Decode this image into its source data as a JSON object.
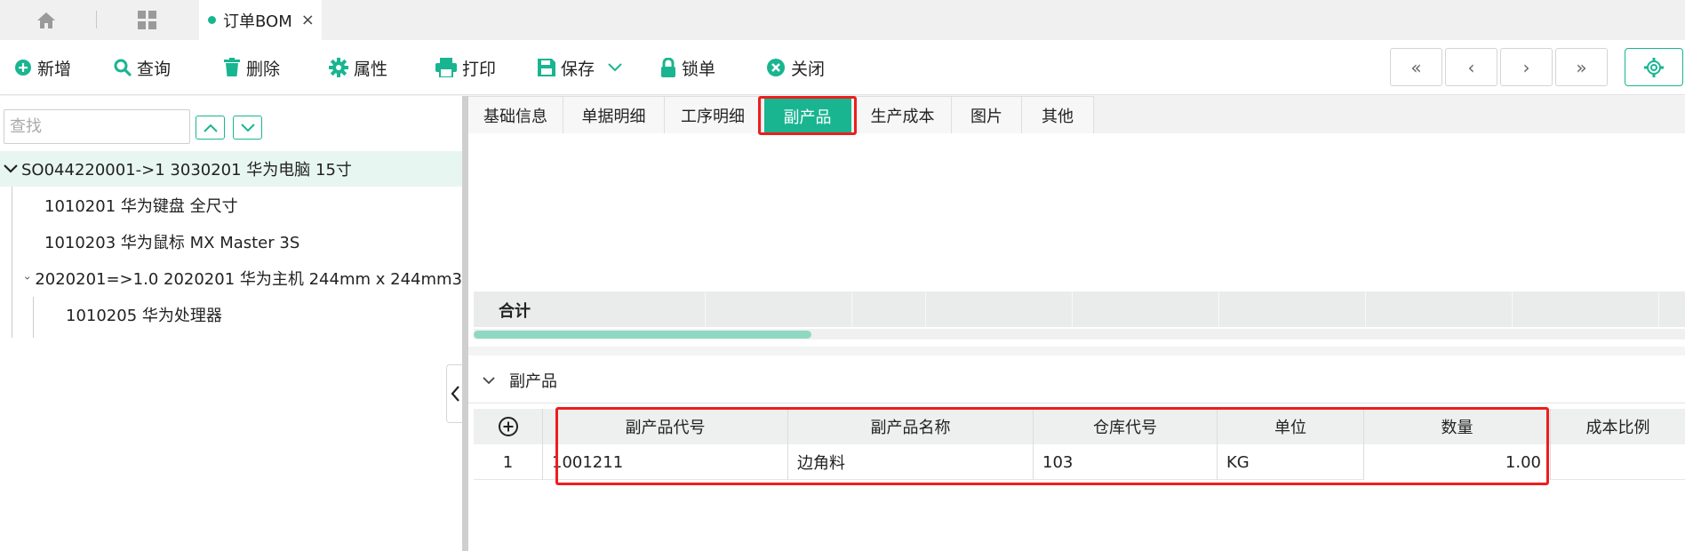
{
  "doc_tab": {
    "title": "订单BOM",
    "close": "×"
  },
  "toolbar": {
    "add": "新增",
    "query": "查询",
    "delete": "删除",
    "properties": "属性",
    "print": "打印",
    "save": "保存",
    "lock": "锁单",
    "close": "关闭"
  },
  "nav": {
    "first": "«",
    "prev": "‹",
    "next": "›",
    "last": "»"
  },
  "search": {
    "placeholder": "查找",
    "value": ""
  },
  "tree": {
    "root": "SO044220001->1 3030201 华为电脑 15寸",
    "items": [
      "1010201 华为键盘 全尺寸",
      "1010203 华为鼠标 MX Master 3S",
      "2020201=>1.0 2020201 华为主机 244mm x 244mm3",
      "1010205 华为处理器"
    ]
  },
  "tabs": [
    "基础信息",
    "单据明细",
    "工序明细",
    "副产品",
    "生产成本",
    "图片",
    "其他"
  ],
  "active_tab": "副产品",
  "upper_grid": {
    "sum_label": "合计"
  },
  "section": {
    "title": "副产品"
  },
  "grid": {
    "columns": [
      "副产品代号",
      "副产品名称",
      "仓库代号",
      "单位",
      "数量",
      "成本比例"
    ],
    "rows": [
      {
        "index": "1",
        "code": "1001211",
        "name": "边角料",
        "warehouse": "103",
        "unit": "KG",
        "qty": "1.00",
        "ratio": ""
      }
    ]
  },
  "colors": {
    "accent": "#19b591",
    "highlight": "#ee1d1d"
  }
}
